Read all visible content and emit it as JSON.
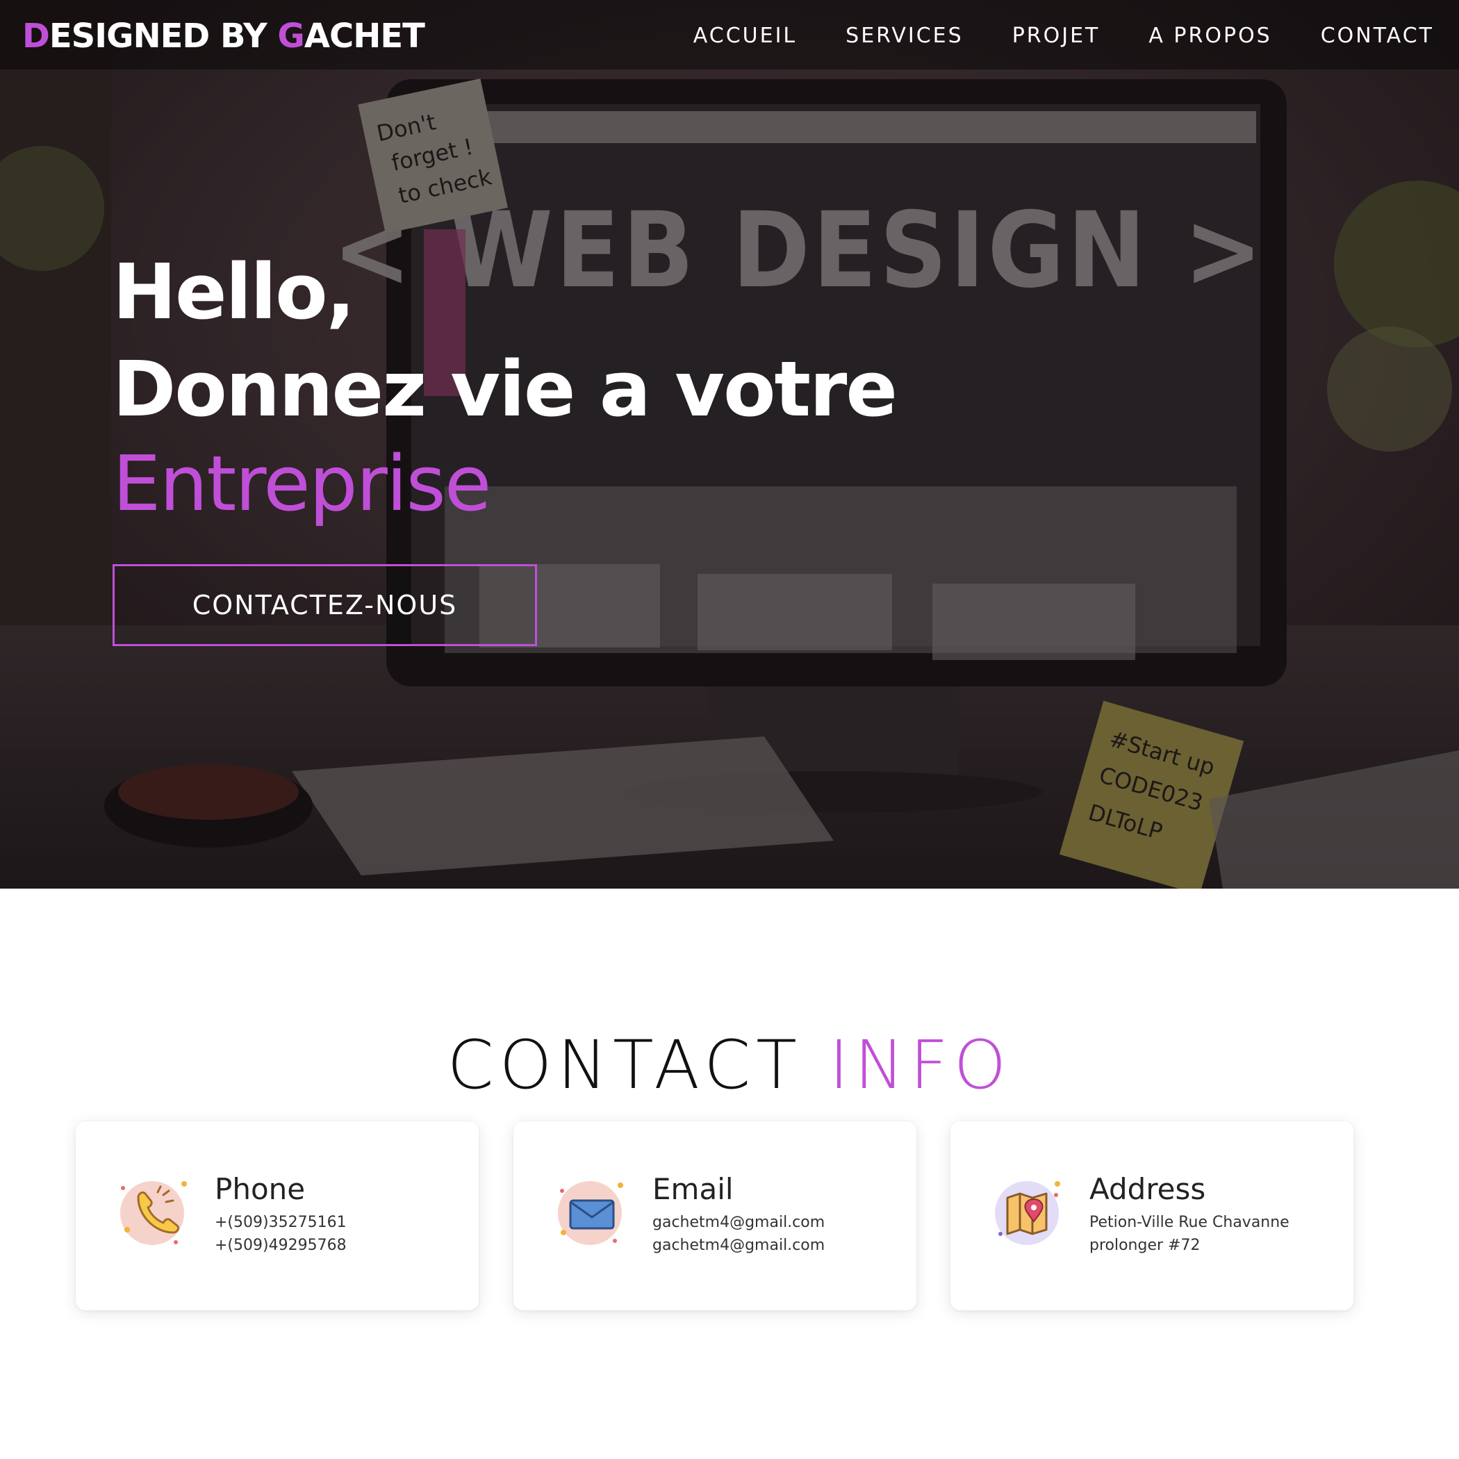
{
  "navbar": {
    "brand": {
      "d": "D",
      "mid": "ESIGNED BY ",
      "g": "G",
      "rest": "ACHET"
    },
    "items": [
      "ACCUEIL",
      "SERVICES",
      "PROJET",
      "A PROPOS",
      "CONTACT"
    ]
  },
  "hero": {
    "line1": "Hello,",
    "line2": "Donnez vie a votre",
    "line3": "Entreprise",
    "cta_label": "CONTACTEZ-NOUS",
    "background": {
      "screen_heading": "< WEB DESIGN >",
      "sticky_note_1": [
        "Don't",
        "forget !",
        "to check"
      ],
      "sticky_note_2": [
        "#Start up",
        "CODE023",
        "DLToLP"
      ]
    }
  },
  "contact": {
    "title_main": "CONTACT ",
    "title_accent": "INFO",
    "cards": [
      {
        "title": "Phone",
        "line1": "+(509)35275161",
        "line2": "+(509)49295768",
        "icon": "phone-icon"
      },
      {
        "title": "Email",
        "line1": "gachetm4@gmail.com",
        "line2": "gachetm4@gmail.com",
        "icon": "envelope-icon"
      },
      {
        "title": "Address",
        "line1": "Petion-Ville Rue Chavanne",
        "line2": "prolonger #72",
        "icon": "map-pin-icon"
      }
    ]
  },
  "colors": {
    "accent": "#c04fd8",
    "text_dark": "#111111"
  }
}
